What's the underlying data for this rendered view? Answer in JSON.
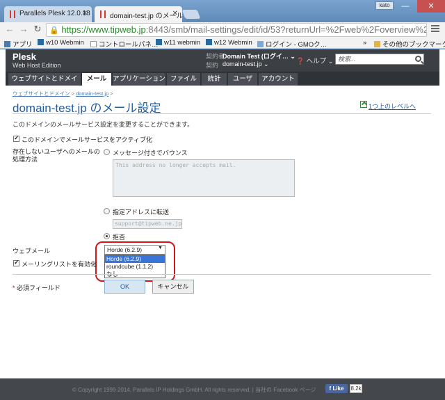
{
  "browser": {
    "tabs": [
      {
        "label": "Parallels Plesk 12.0.18",
        "active": false
      },
      {
        "label": "domain-test.jp のメール",
        "active": true
      }
    ],
    "user_badge": "kato",
    "url_scheme": "https://",
    "url_host": "www.tipweb.jp",
    "url_path": ":8443/smb/mail-settings/edit/id/53?returnUrl=%2Fweb%2Foverview%2Fid%",
    "bookmarks": [
      "アプリ",
      "w10 Webmin",
      "コントロールパネ…",
      "w11 webmin",
      "w12 Webmin",
      "ログイン - GMOク…",
      "»",
      "その他のブックマーク"
    ]
  },
  "header": {
    "brand": "Plesk",
    "edition": "Web Host Edition",
    "owner_label": "契約者",
    "owner_value": "Domain Test (ログイ… ⌄",
    "subscription_label": "契約",
    "subscription_value": "domain-test.jp ⌄",
    "help_label": "ヘルプ ⌄",
    "search_placeholder": "検索..."
  },
  "nav_tabs": [
    "ウェブサイトとドメイン",
    "メール",
    "アプリケーション",
    "ファイル",
    "統計",
    "ユーザ",
    "アカウント"
  ],
  "breadcrumb": {
    "item1": "ウェブサイトとドメイン",
    "sep": ">",
    "item2": "domain-test.jp",
    "sep2": ">"
  },
  "title": "domain-test.jp のメール設定",
  "up_level": "1つ上のレベルへ",
  "description": "このドメインのメールサービス設定を変更することができます。",
  "form": {
    "activate_label": "このドメインでメールサービスをアクティブ化",
    "nonexistent_label": "存在しないユーザへのメールの処理方法",
    "opt_bounce": "メッセージ付きでバウンス",
    "bounce_message": "This address no longer accepts mail.",
    "opt_forward": "指定アドレスに転送",
    "forward_placeholder": "support@tipweb.ne.jp",
    "opt_reject": "拒否",
    "webmail_label": "ウェブメール",
    "webmail_selected": "Horde (6.2.9)",
    "webmail_options": [
      "Horde (6.2.9)",
      "roundcube (1.1.2)",
      "なし"
    ],
    "mailinglist_label": "メーリングリストを有効化",
    "required_star": "*",
    "required_label": "必須フィールド",
    "ok_label": "OK",
    "cancel_label": "キャンセル"
  },
  "footer": {
    "copyright": "© Copyright 1999-2014, Parallels IP Holdings GmbH. All rights reserved.   |   当社の Facebook ページ",
    "like_label": "Like",
    "like_count": "8.2k"
  },
  "colors": {
    "accent": "#225fa3",
    "highlight": "#d0151d",
    "header": "#3c3f44"
  }
}
